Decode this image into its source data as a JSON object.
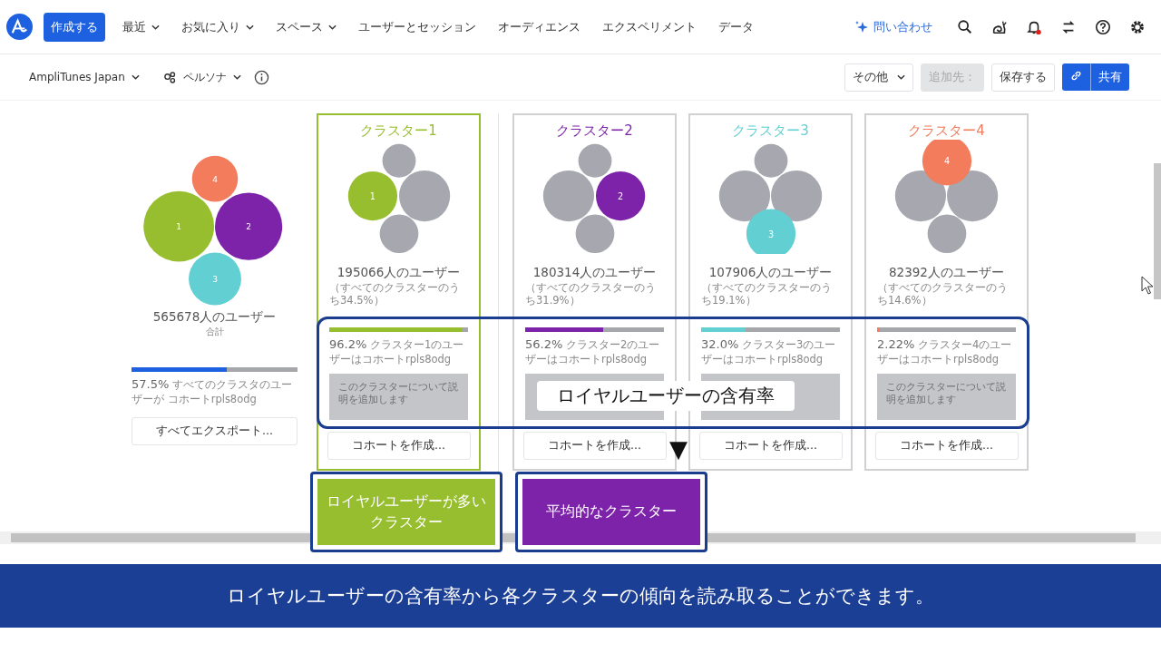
{
  "nav": {
    "create_button": "作成する",
    "items": [
      {
        "label": "最近",
        "dropdown": true
      },
      {
        "label": "お気に入り",
        "dropdown": true
      },
      {
        "label": "スペース",
        "dropdown": true
      },
      {
        "label": "ユーザーとセッション",
        "dropdown": false
      },
      {
        "label": "オーディエンス",
        "dropdown": false
      },
      {
        "label": "エクスペリメント",
        "dropdown": false
      },
      {
        "label": "データ",
        "dropdown": false
      }
    ],
    "contact": "問い合わせ"
  },
  "toolbar": {
    "project": "AmpliTunes Japan",
    "persona": "ペルソナ",
    "more": "その他",
    "add_to": "追加先：",
    "add_to_disabled": true,
    "save": "保存する",
    "share": "共有"
  },
  "overview": {
    "bubbles": [
      {
        "label": "1",
        "color": "#97be2e"
      },
      {
        "label": "2",
        "color": "#7d23a9"
      },
      {
        "label": "3",
        "color": "#62d0d2"
      },
      {
        "label": "4",
        "color": "#f27c5c"
      }
    ],
    "users": "565678人のユーザー",
    "caption": "合計",
    "level": 0.575,
    "loyal_percent": "57.5%",
    "loyal_text": "すべてのクラスタのユーザーが コホートrpls8odg",
    "export": "すべてエクスポート..."
  },
  "clusters": [
    {
      "title": "クラスター1",
      "color": "#97be2e",
      "selected": true,
      "bubble_label": "1",
      "users": "195066人のユーザー",
      "share": "（すべてのクラスターのうち34.5%）",
      "level": 0.962,
      "loyal_percent": "96.2%",
      "loyal_text": "クラスター1のユーザーはコホートrpls8odg",
      "description": "このクラスターについて説明を追加します",
      "button": "コホートを作成..."
    },
    {
      "title": "クラスター2",
      "color": "#7d23a9",
      "selected": false,
      "bubble_label": "2",
      "users": "180314人のユーザー",
      "share": "（すべてのクラスターのうち31.9%）",
      "level": 0.562,
      "loyal_percent": "56.2%",
      "loyal_text": "クラスター2のユーザーはコホートrpls8odg",
      "button": "コホートを作成..."
    },
    {
      "title": "クラスター3",
      "color": "#62d0d2",
      "selected": false,
      "bubble_label": "3",
      "users": "107906人のユーザー",
      "share": "（すべてのクラスターのうち19.1%）",
      "level": 0.32,
      "loyal_percent": "32.0%",
      "loyal_text": "クラスター3のユーザーはコホートrpls8odg",
      "button": "コホートを作成..."
    },
    {
      "title": "クラスター4",
      "color": "#f27c5c",
      "selected": false,
      "bubble_label": "4",
      "users": "82392人のユーザー",
      "share": "（すべてのクラスターのうち14.6%）",
      "level": 0.0222,
      "loyal_percent": "2.22%",
      "loyal_text": "クラスター4のユーザーはコホートrpls8odg",
      "description": "このクラスターについて説明を追加します",
      "button": "コホートを作成..."
    }
  ],
  "annotations": {
    "highlight_label": "ロイヤルユーザーの含有率",
    "callouts": [
      {
        "text": "ロイヤルユーザーが多いクラスター",
        "color": "#97be2e"
      },
      {
        "text": "平均的なクラスター",
        "color": "#7d23a9"
      }
    ],
    "arrow": "▼"
  },
  "caption": "ロイヤルユーザーの含有率から各クラスターの傾向を読み取ることができます。"
}
